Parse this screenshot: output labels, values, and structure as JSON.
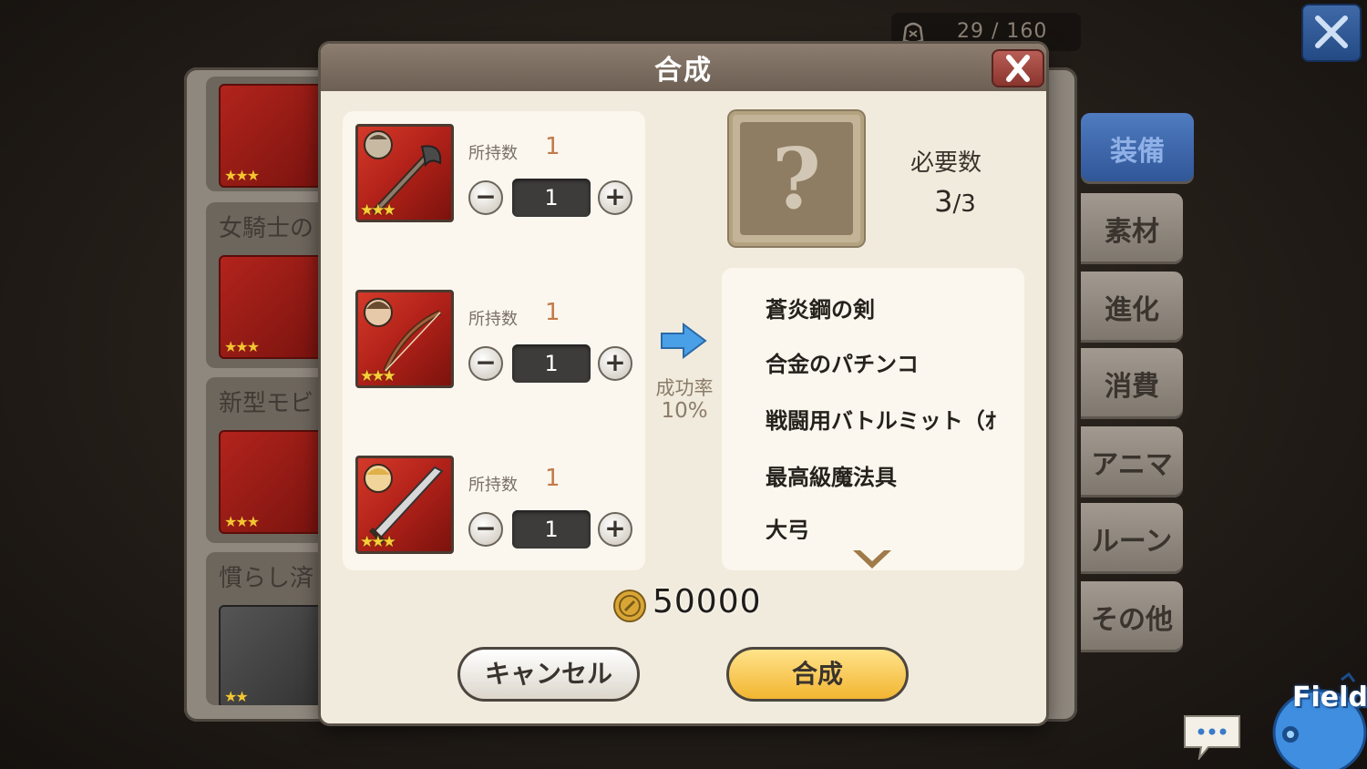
{
  "capacity": {
    "text": "29 / 160"
  },
  "background_panel": {
    "items": [
      {
        "label": "",
        "stars": "★★★"
      },
      {
        "label": "女騎士の",
        "stars": "★★★"
      },
      {
        "label": "新型モビ",
        "stars": "★★★"
      },
      {
        "label": "慣らし済",
        "stars": "★★"
      }
    ]
  },
  "side_tabs": [
    "装備",
    "素材",
    "進化",
    "消費",
    "アニマ",
    "ルーン",
    "その他"
  ],
  "modal": {
    "title": "合成",
    "materials": [
      {
        "owned_label": "所持数",
        "owned": "1",
        "qty": "1",
        "stars": "★★★",
        "icon": "staff-icon"
      },
      {
        "owned_label": "所持数",
        "owned": "1",
        "qty": "1",
        "stars": "★★★",
        "icon": "bow-icon"
      },
      {
        "owned_label": "所持数",
        "owned": "1",
        "qty": "1",
        "stars": "★★★",
        "icon": "sword-icon"
      }
    ],
    "success_rate_label": "成功率",
    "success_rate": "10%",
    "result": {
      "unknown_symbol": "?",
      "required_label": "必要数",
      "required_current": "3",
      "required_total": "/3"
    },
    "recipes": [
      "蒼炎鋼の剣",
      "合金のパチンコ",
      "戦闘用バトルミット（ｵ",
      "最高級魔法具",
      "大弓"
    ],
    "cost": "50000",
    "cancel_label": "キャンセル",
    "synthesize_label": "合成"
  },
  "field_label": "Field",
  "colors": {
    "accent_blue": "#2f5596",
    "synth_button": "#f2b531",
    "card_red": "#b4231a"
  }
}
